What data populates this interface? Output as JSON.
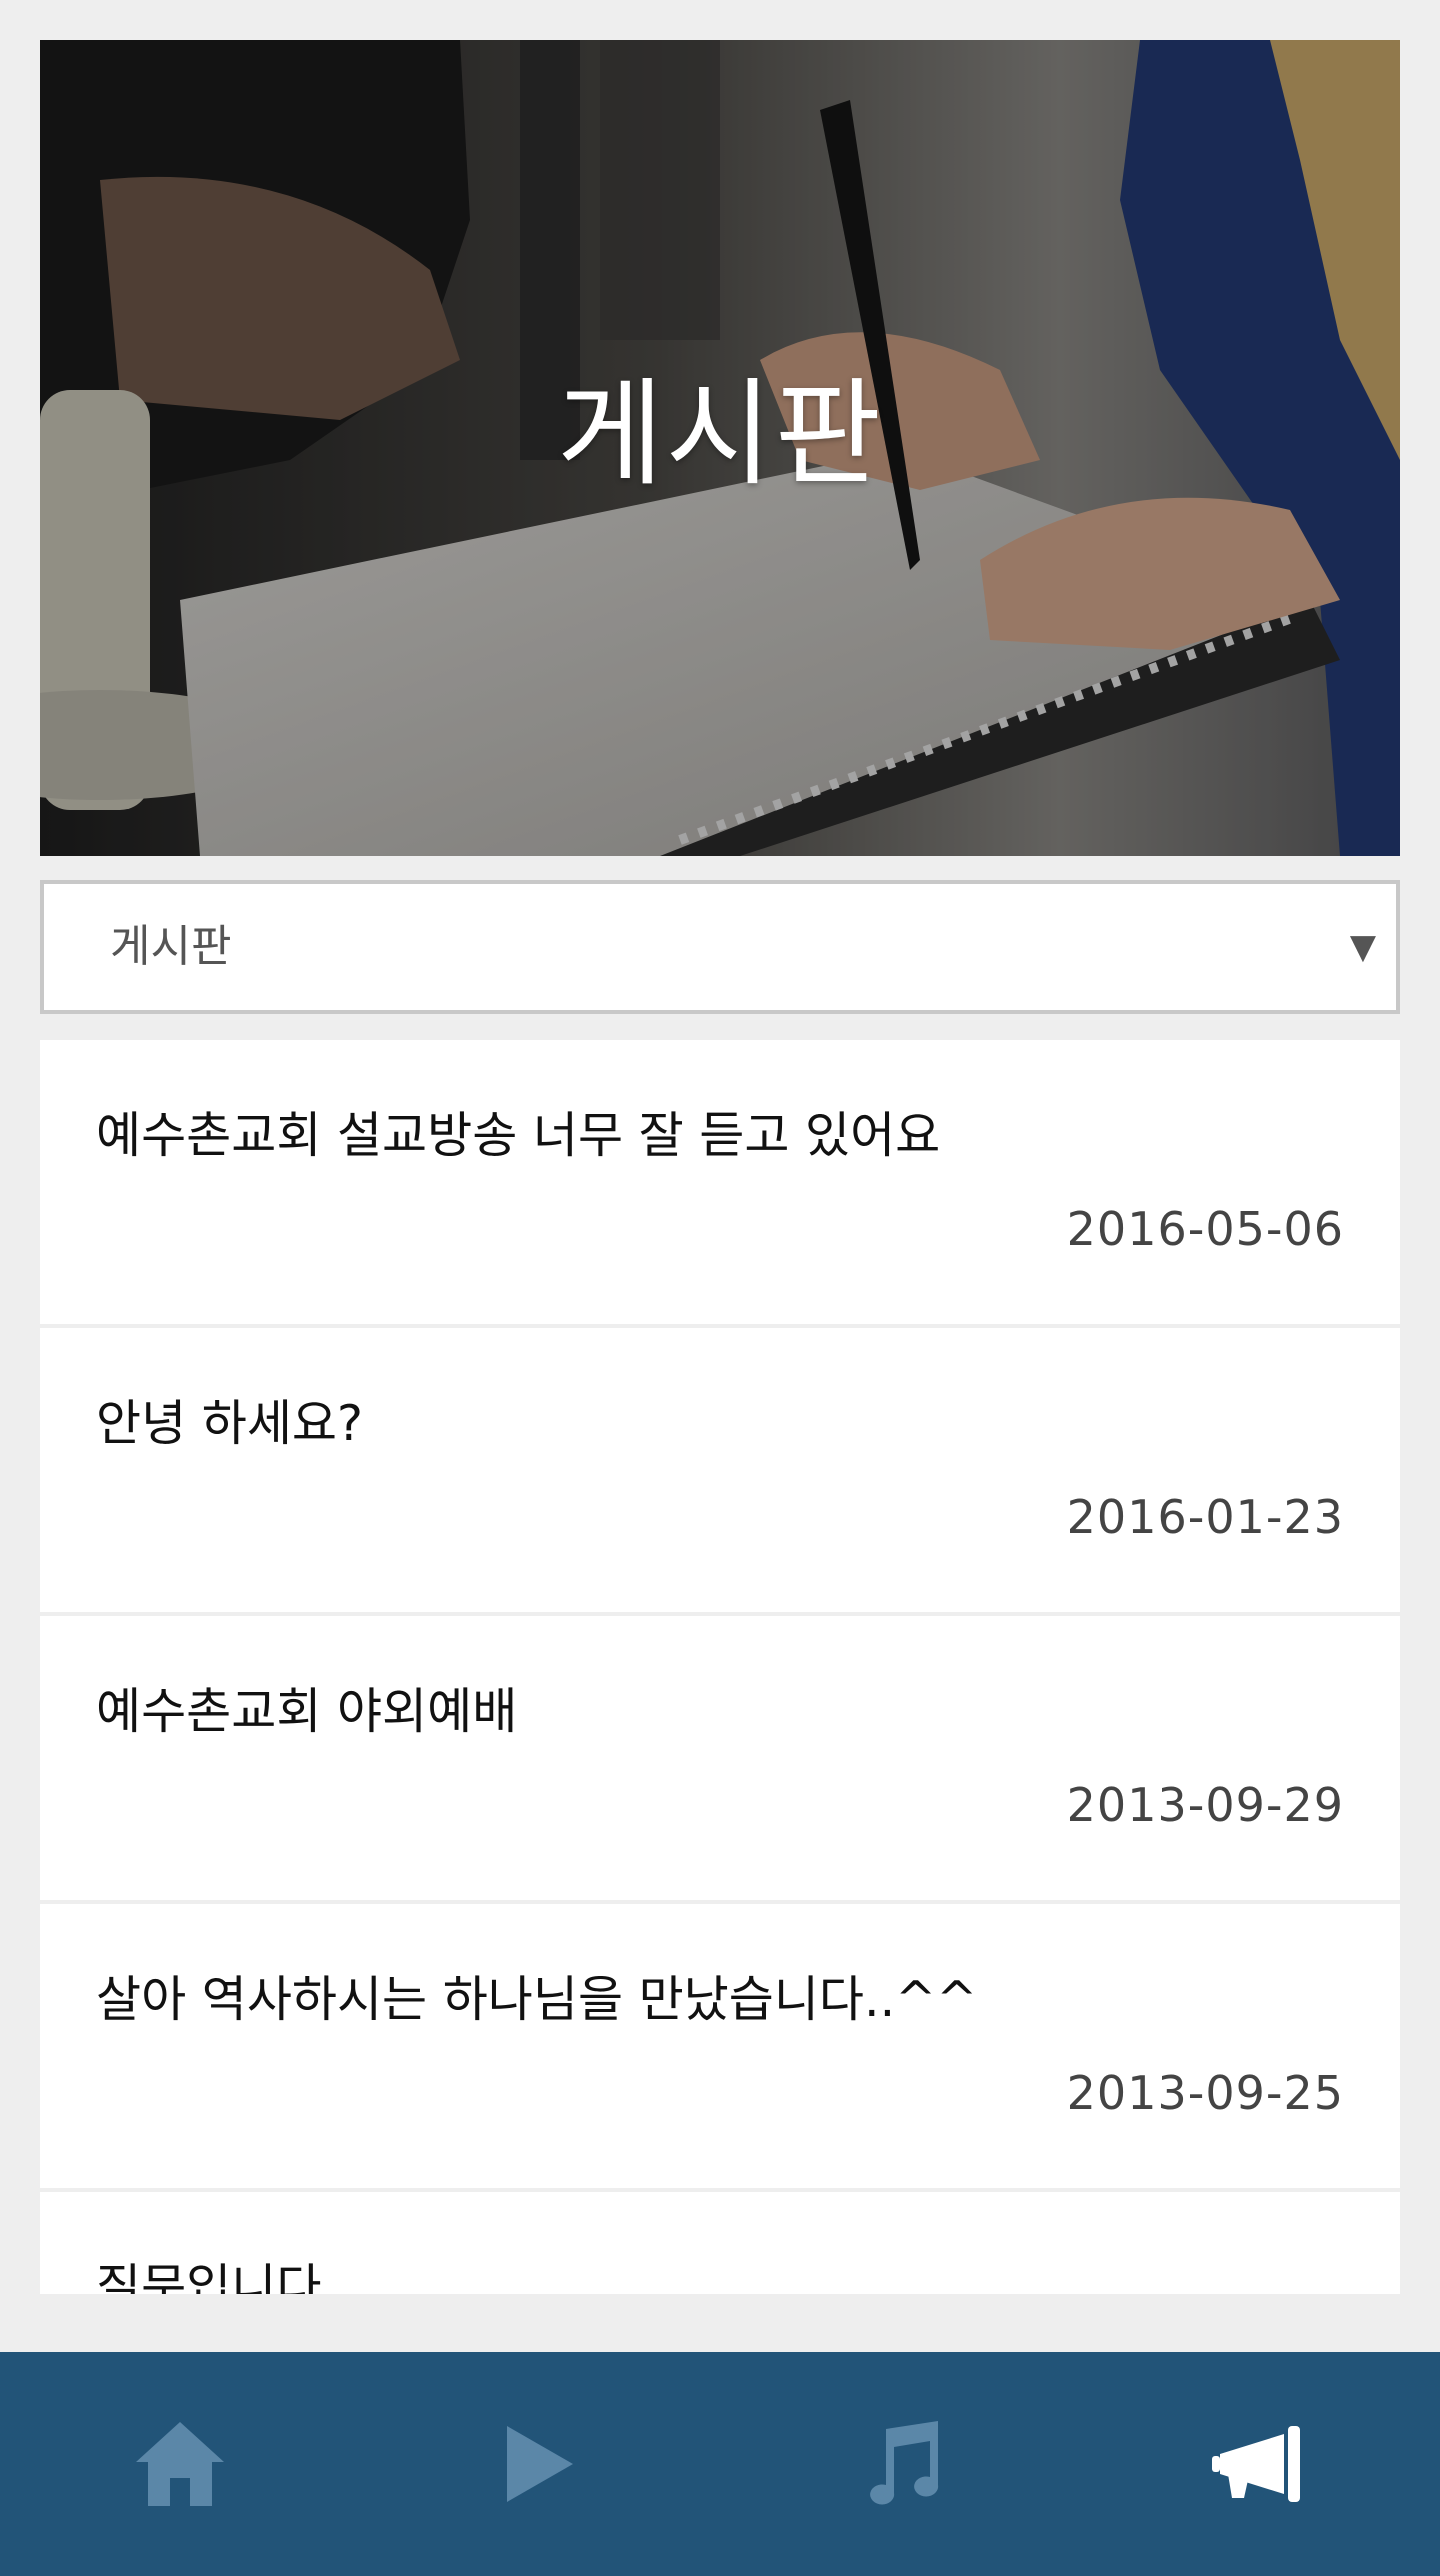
{
  "hero": {
    "title": "게시판"
  },
  "category_select": {
    "selected": "게시판",
    "arrow": "▼"
  },
  "posts": [
    {
      "title": "예수촌교회 설교방송 너무 잘 듣고 있어요",
      "date": "2016-05-06"
    },
    {
      "title": "안녕 하세요?",
      "date": "2016-01-23"
    },
    {
      "title": "예수촌교회 야외예배",
      "date": "2013-09-29"
    },
    {
      "title": "살아 역사하시는 하나님을 만났습니다..^^",
      "date": "2013-09-25"
    },
    {
      "title": "질문입니다.",
      "date": ""
    }
  ],
  "tabbar": {
    "background": "#225478",
    "tabs": [
      {
        "icon": "home-icon",
        "active": false
      },
      {
        "icon": "play-icon",
        "active": false
      },
      {
        "icon": "music-note-icon",
        "active": false
      },
      {
        "icon": "megaphone-icon",
        "active": true
      }
    ],
    "inactive_color": "#5b87a8",
    "active_color": "#ffffff"
  }
}
